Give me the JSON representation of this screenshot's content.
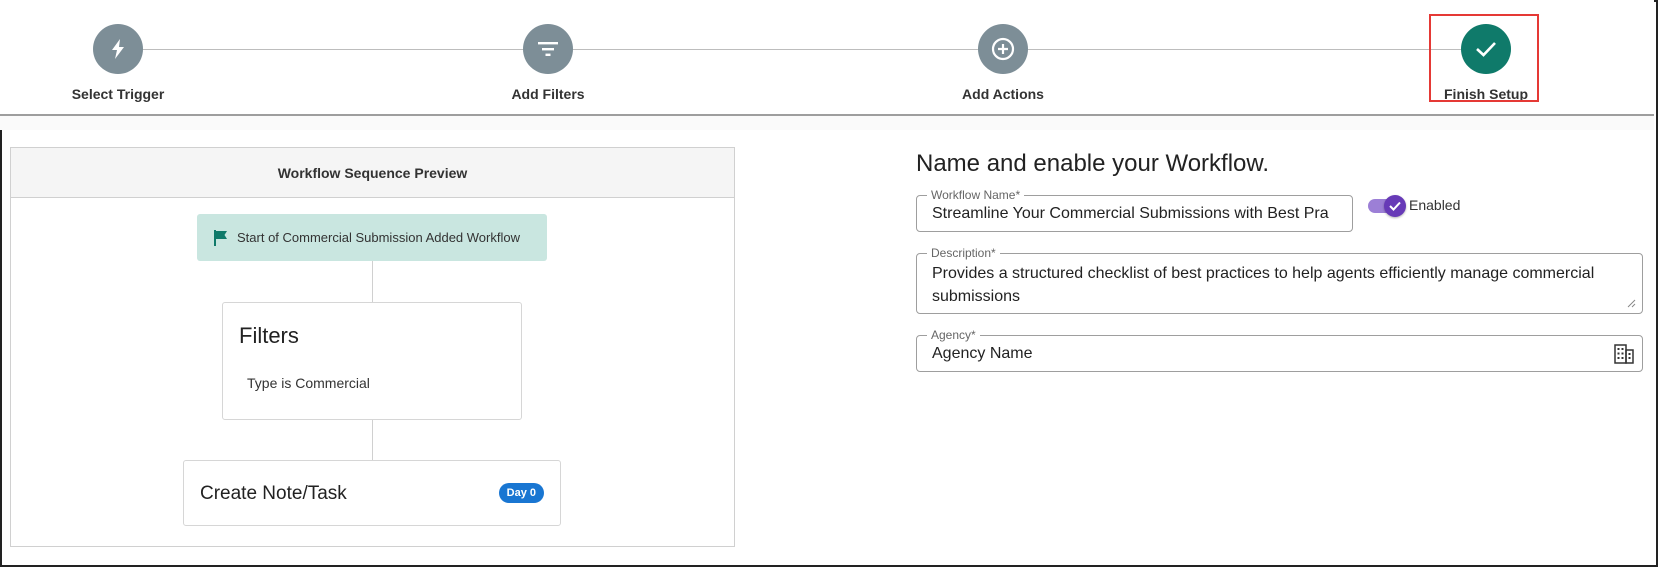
{
  "stepper": {
    "steps": [
      {
        "label": "Select Trigger",
        "icon": "lightning-icon",
        "status": "complete"
      },
      {
        "label": "Add Filters",
        "icon": "filter-icon",
        "status": "complete"
      },
      {
        "label": "Add Actions",
        "icon": "plus-circle-icon",
        "status": "complete"
      },
      {
        "label": "Finish Setup",
        "icon": "check-icon",
        "status": "current"
      }
    ],
    "step_color": "#7d8e97",
    "current_color": "#0f7a6a",
    "highlight_color": "#e53935"
  },
  "preview": {
    "header": "Workflow Sequence Preview",
    "start_node": "Start of Commercial Submission Added Workflow",
    "filters": {
      "title": "Filters",
      "items": [
        "Type is Commercial"
      ]
    },
    "action": {
      "title": "Create Note/Task",
      "badge": "Day 0",
      "badge_color": "#1976d2"
    }
  },
  "form": {
    "title": "Name and enable your Workflow.",
    "workflow_name": {
      "label": "Workflow Name*",
      "value": "Streamline Your Commercial Submissions with Best Pra"
    },
    "enabled": {
      "label": "Enabled",
      "checked": true,
      "color": "#673ab7"
    },
    "description": {
      "label": "Description*",
      "value": "Provides a structured checklist of best practices to help agents efficiently manage commercial submissions"
    },
    "agency": {
      "label": "Agency*",
      "value": "Agency Name"
    }
  }
}
